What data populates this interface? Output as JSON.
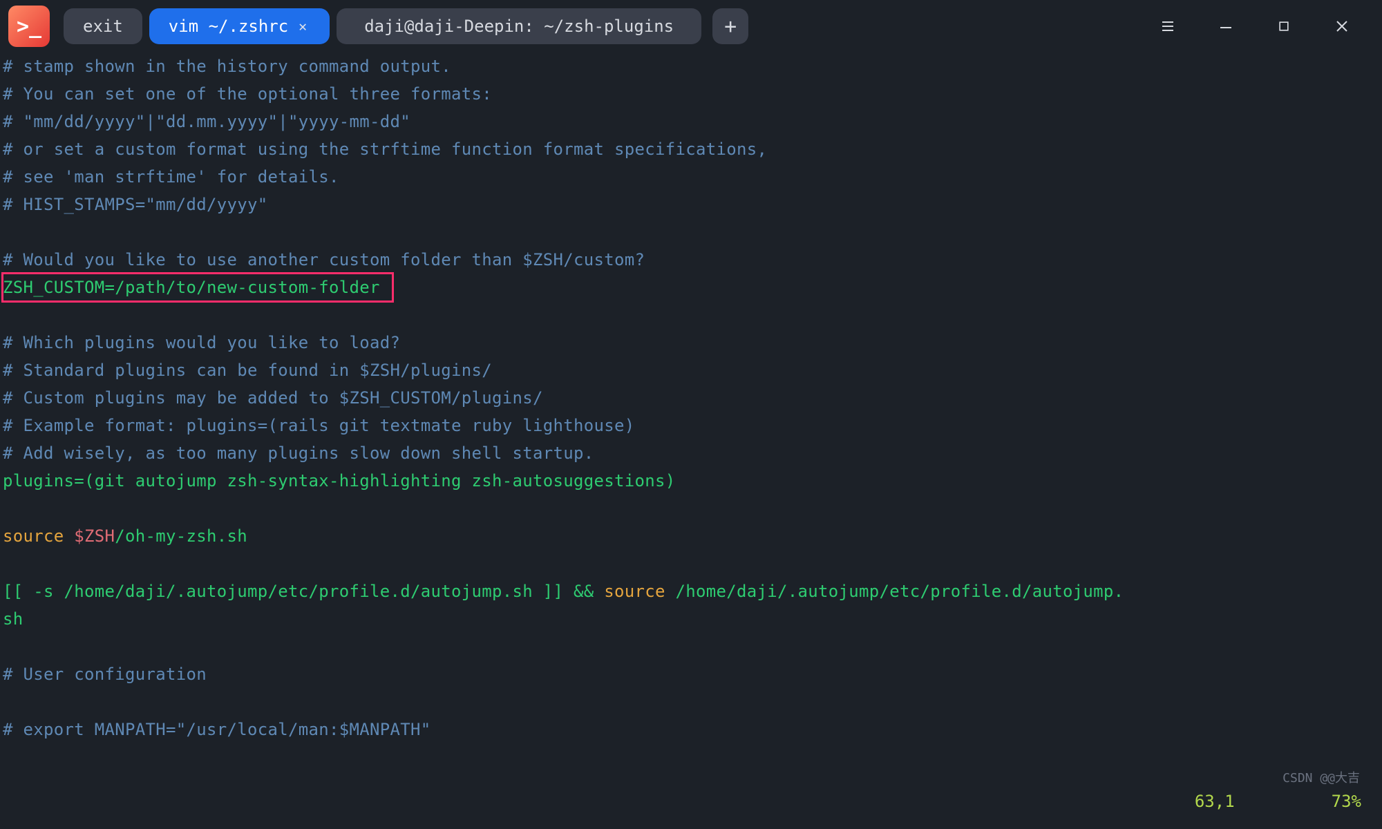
{
  "titlebar": {
    "tabs": [
      {
        "label": "exit",
        "active": false,
        "closable": false
      },
      {
        "label": "vim ~/.zshrc",
        "active": true,
        "closable": true
      },
      {
        "label": "daji@daji-Deepin: ~/zsh-plugins",
        "active": false,
        "closable": false
      }
    ],
    "new_tab_label": "+"
  },
  "editor": {
    "lines": [
      {
        "cls": "c-comment",
        "text": "# stamp shown in the history command output."
      },
      {
        "cls": "c-comment",
        "text": "# You can set one of the optional three formats:"
      },
      {
        "cls": "c-comment",
        "text": "# \"mm/dd/yyyy\"|\"dd.mm.yyyy\"|\"yyyy-mm-dd\""
      },
      {
        "cls": "c-comment",
        "text": "# or set a custom format using the strftime function format specifications,"
      },
      {
        "cls": "c-comment",
        "text": "# see 'man strftime' for details."
      },
      {
        "cls": "c-comment",
        "text": "# HIST_STAMPS=\"mm/dd/yyyy\""
      },
      {
        "cls": "c-default",
        "text": ""
      },
      {
        "cls": "c-comment",
        "text": "# Would you like to use another custom folder than $ZSH/custom?"
      }
    ],
    "highlighted_line": "ZSH_CUSTOM=/path/to/new-custom-folder",
    "lines2": [
      {
        "cls": "c-default",
        "text": ""
      },
      {
        "cls": "c-comment",
        "text": "# Which plugins would you like to load?"
      },
      {
        "cls": "c-comment",
        "text": "# Standard plugins can be found in $ZSH/plugins/"
      },
      {
        "cls": "c-comment",
        "text": "# Custom plugins may be added to $ZSH_CUSTOM/plugins/"
      },
      {
        "cls": "c-comment",
        "text": "# Example format: plugins=(rails git textmate ruby lighthouse)"
      },
      {
        "cls": "c-comment",
        "text": "# Add wisely, as too many plugins slow down shell startup."
      },
      {
        "cls": "c-green",
        "text": "plugins=(git autojump zsh-syntax-highlighting zsh-autosuggestions)"
      },
      {
        "cls": "c-default",
        "text": ""
      }
    ],
    "source_line": {
      "kw": "source",
      "var": " $ZSH",
      "rest": "/oh-my-zsh.sh"
    },
    "autojump_line": {
      "test_part": "[[ -s /home/daji/.autojump/etc/profile.d/autojump.sh ]] && ",
      "kw": "source",
      "path": " /home/daji/.autojump/etc/profile.d/autojump.sh"
    },
    "lines3": [
      {
        "cls": "c-default",
        "text": ""
      },
      {
        "cls": "c-comment",
        "text": "# User configuration"
      },
      {
        "cls": "c-default",
        "text": ""
      },
      {
        "cls": "c-comment",
        "text": "# export MANPATH=\"/usr/local/man:$MANPATH\""
      }
    ]
  },
  "status": {
    "position": "63,1",
    "percent": "73%"
  },
  "watermark": "CSDN @@大吉"
}
